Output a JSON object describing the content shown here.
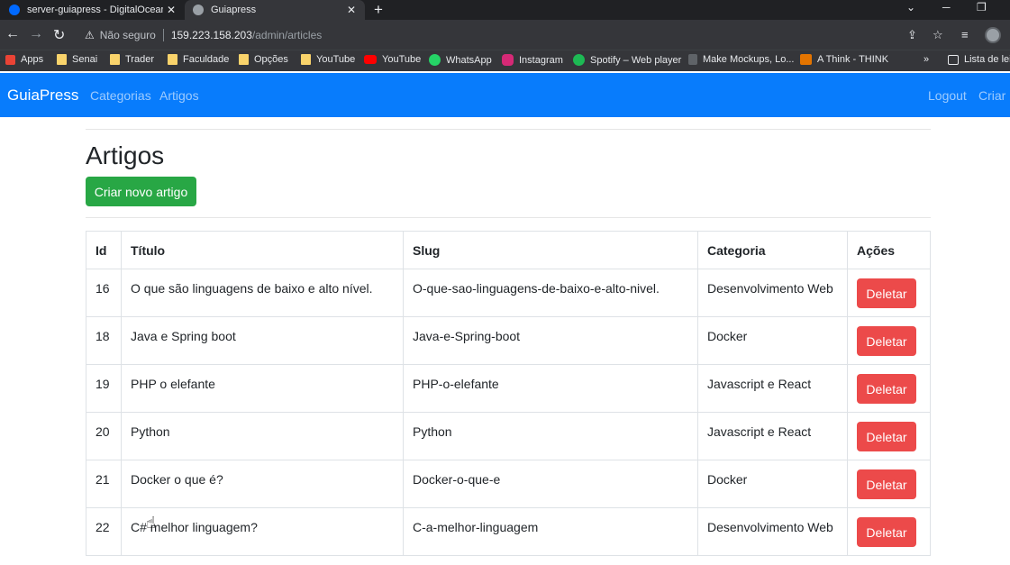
{
  "browser": {
    "tabs": [
      {
        "title": "server-guiapress - DigitalOcean"
      },
      {
        "title": "Guiapress"
      }
    ],
    "address": {
      "security": "Não seguro",
      "host": "159.223.158.203",
      "path": "/admin/articles"
    },
    "bookmarks": [
      {
        "label": "Apps",
        "icon": "apps-grid-icon"
      },
      {
        "label": "Senai",
        "icon": "folder-icon"
      },
      {
        "label": "Trader",
        "icon": "folder-icon"
      },
      {
        "label": "Faculdade",
        "icon": "folder-icon"
      },
      {
        "label": "Opções",
        "icon": "folder-icon"
      },
      {
        "label": "YouTube",
        "icon": "folder-icon"
      },
      {
        "label": "YouTube",
        "icon": "youtube-icon"
      },
      {
        "label": "WhatsApp",
        "icon": "whatsapp-icon"
      },
      {
        "label": "Instagram",
        "icon": "instagram-icon"
      },
      {
        "label": "Spotify – Web player",
        "icon": "spotify-icon"
      },
      {
        "label": "Make Mockups, Lo...",
        "icon": "mockups-icon"
      },
      {
        "label": "A Think - THINK",
        "icon": "think-icon"
      }
    ],
    "reading_list": "Lista de leit",
    "colors": {
      "youtube": "#ff0000",
      "whatsapp": "#25d366",
      "instagram": "#d62976",
      "spotify": "#1db954",
      "folder": "#f9d36b"
    }
  },
  "navbar": {
    "brand": "GuiaPress",
    "links": [
      "Categorias",
      "Artigos"
    ],
    "right": [
      "Logout",
      "Criar"
    ],
    "color": "#087cfc"
  },
  "page": {
    "title": "Artigos",
    "new_button": "Criar novo artigo",
    "columns": [
      "Id",
      "Título",
      "Slug",
      "Categoria",
      "Ações"
    ],
    "rows": [
      {
        "id": "16",
        "title": "O que são linguagens de baixo e alto nível.",
        "slug": "O-que-sao-linguagens-de-baixo-e-alto-nivel.",
        "category": "Desenvolvimento Web",
        "action": "Deletar"
      },
      {
        "id": "18",
        "title": "Java e Spring boot",
        "slug": "Java-e-Spring-boot",
        "category": "Docker",
        "action": "Deletar"
      },
      {
        "id": "19",
        "title": "PHP o elefante",
        "slug": "PHP-o-elefante",
        "category": "Javascript e React",
        "action": "Deletar"
      },
      {
        "id": "20",
        "title": "Python",
        "slug": "Python",
        "category": "Javascript e React",
        "action": "Deletar"
      },
      {
        "id": "21",
        "title": "Docker o que é?",
        "slug": "Docker-o-que-e",
        "category": "Docker",
        "action": "Deletar"
      },
      {
        "id": "22",
        "title": "C# melhor linguagem?",
        "slug": "C-a-melhor-linguagem",
        "category": "Desenvolvimento Web",
        "action": "Deletar"
      }
    ],
    "colors": {
      "create": "#28a745",
      "delete": "#ec4a4a"
    }
  }
}
